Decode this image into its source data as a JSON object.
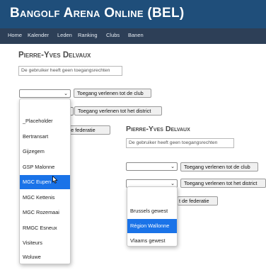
{
  "app": {
    "title": "Bangolf Arena Online (BEL)"
  },
  "nav": {
    "items": [
      "Home",
      "Kalender",
      "Leden",
      "Ranking",
      "Clubs",
      "Banen"
    ]
  },
  "user": {
    "name": "Pierre-Yves Delvaux"
  },
  "rights_note": "De gebruiker heeft geen toegangsrechten",
  "buttons": {
    "club": "Toegang verlenen tot de club",
    "district": "Toegang verlenen tot het district",
    "federation": "Toegang verlenen tot de federatie",
    "federation_visible": "t de federatie",
    "federation_back_visible": "ot de federatie"
  },
  "club_options": [
    "_Placeholder",
    "Bertransart",
    "Gijzegem",
    "GSP Malonne",
    "MGC Eupen",
    "MGC Kettenis",
    "MGC Rozemaai",
    "RMGC Esneux",
    "Visiteurs",
    "Woluwe"
  ],
  "club_selected": "MGC Eupen",
  "district_options": [
    "Brussels gewest",
    "Région Wallonne",
    "Vlaams gewest"
  ],
  "district_selected": "Région Wallonne",
  "colors": {
    "header": "#1f4e7a",
    "nav": "#2d3f57",
    "selection": "#1a73e8"
  }
}
